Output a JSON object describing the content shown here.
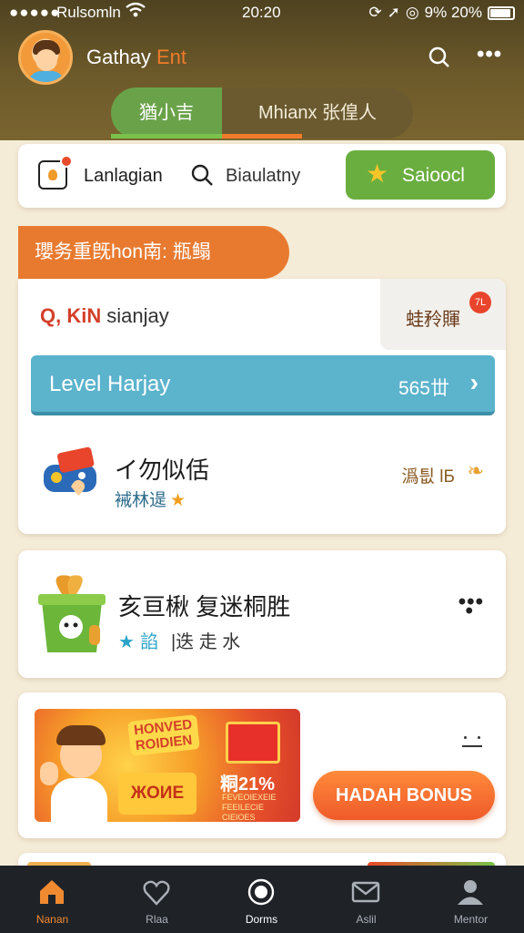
{
  "status_bar": {
    "signal": "●●●●●",
    "carrier": "Rulsomln",
    "time": "20:20",
    "battery": "9% 20%"
  },
  "header": {
    "title": "Gathay",
    "title_accent": "Ent"
  },
  "tabs": [
    {
      "label": "猶小吉",
      "active": true
    },
    {
      "label": "Mhianx  张偟人",
      "active": false
    }
  ],
  "toolbar": {
    "item1_label": "Lanlagian",
    "item2_label": "Biaulatny",
    "button_label": "Saioocl"
  },
  "section_banner": "瓔务重旣hon南: 瓶鳎",
  "main_card": {
    "kin_prefix": "Q, KiN",
    "kin_text": "sianjay",
    "corner_label": "蛙矝賱",
    "corner_badge": "7L",
    "level": {
      "label": "Level Harjay",
      "value": "565丗"
    },
    "game": {
      "title": "イ勿似佸",
      "subtitle": "裓林遈",
      "right_label": "潙틦 lБ"
    }
  },
  "card2": {
    "title": "亥亘楸 复迷桐胜",
    "subtitle_a": "諂",
    "subtitle_b": "|迭 走 水"
  },
  "promo": {
    "sign": [
      "HONVED",
      "ROIDIEN"
    ],
    "bag_text": "ЖOИЕ",
    "percent": "粡21%",
    "fine_print": "FEVEOIEXEIE FEEILECIE CIEIOES",
    "button_label": "HADAH BONUS"
  },
  "nav": [
    {
      "label": "Nanan",
      "icon": "home-icon",
      "active": true
    },
    {
      "label": "Rlaa",
      "icon": "heart-icon",
      "active": false
    },
    {
      "label": "Dorms",
      "icon": "record-icon",
      "active": false
    },
    {
      "label": "Aslil",
      "icon": "mail-icon",
      "active": false
    },
    {
      "label": "Mentor",
      "icon": "person-icon",
      "active": false
    }
  ],
  "colors": {
    "header_bg": "#5a4b24",
    "accent_orange": "#ef7c2a",
    "accent_green": "#6aae3f",
    "accent_teal": "#5bb3cc",
    "nav_bg": "#1f2328"
  }
}
